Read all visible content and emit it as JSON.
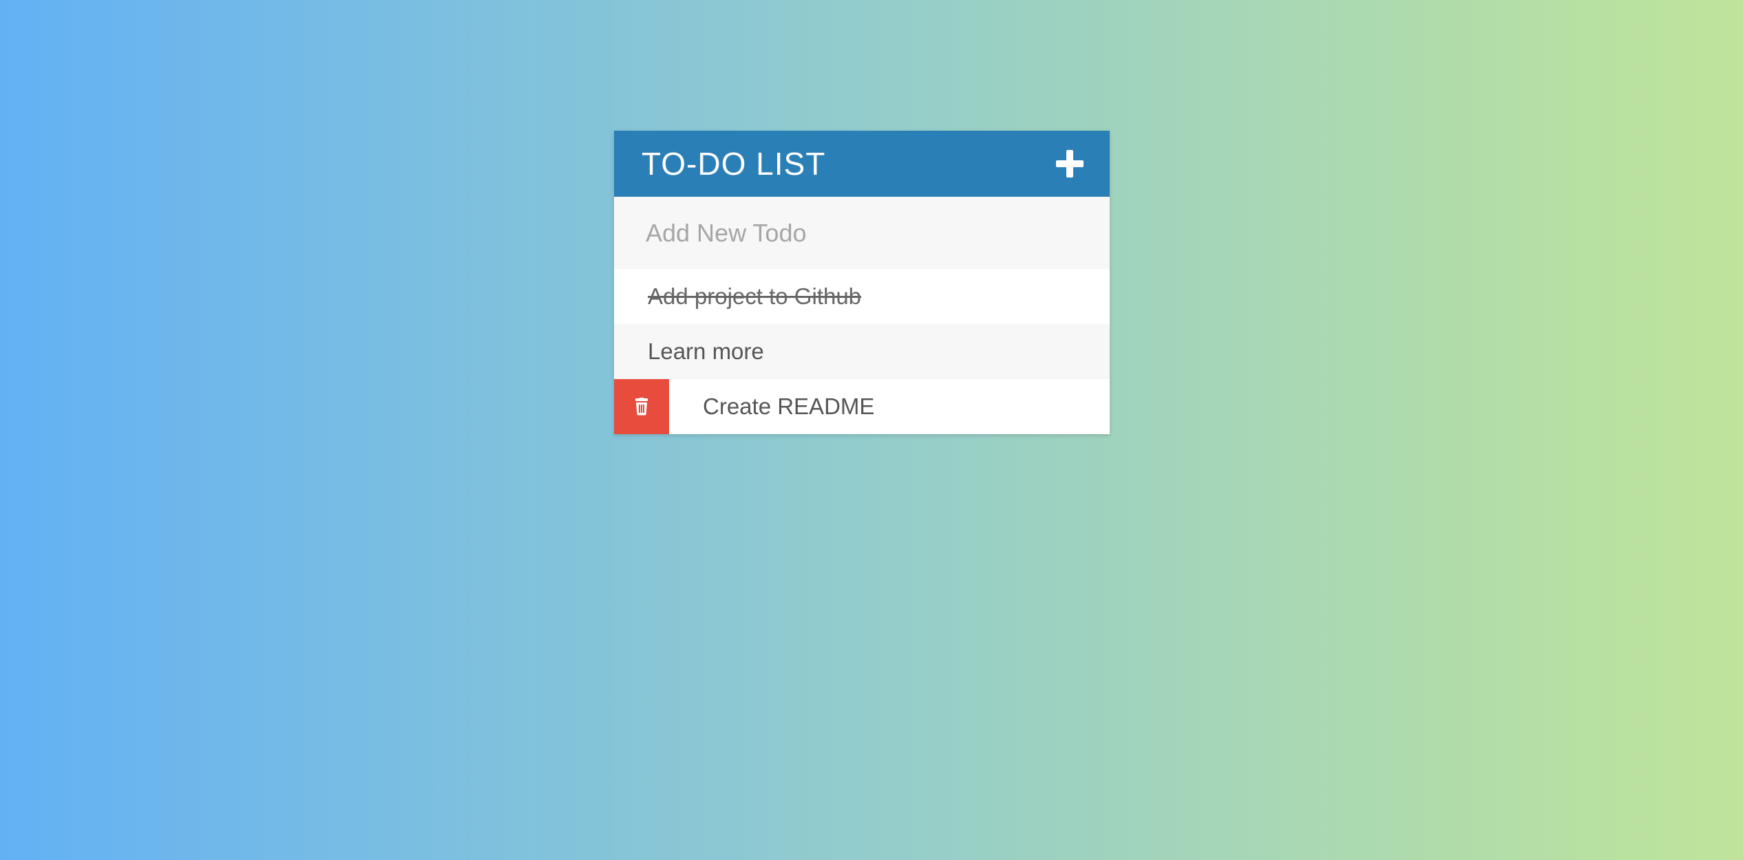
{
  "header": {
    "title": "TO-DO LIST",
    "add_icon": "plus-icon"
  },
  "input": {
    "placeholder": "Add New Todo",
    "value": ""
  },
  "todos": [
    {
      "text": "Add project to Github",
      "completed": true
    },
    {
      "text": "Learn more",
      "completed": false
    },
    {
      "text": "Create README",
      "completed": false,
      "delete_visible": true,
      "delete_icon": "trash-icon"
    }
  ],
  "colors": {
    "header": "#2a7fb7",
    "delete": "#e74c3c",
    "gradient_start": "#63b1f4",
    "gradient_end": "#bfe49a"
  }
}
